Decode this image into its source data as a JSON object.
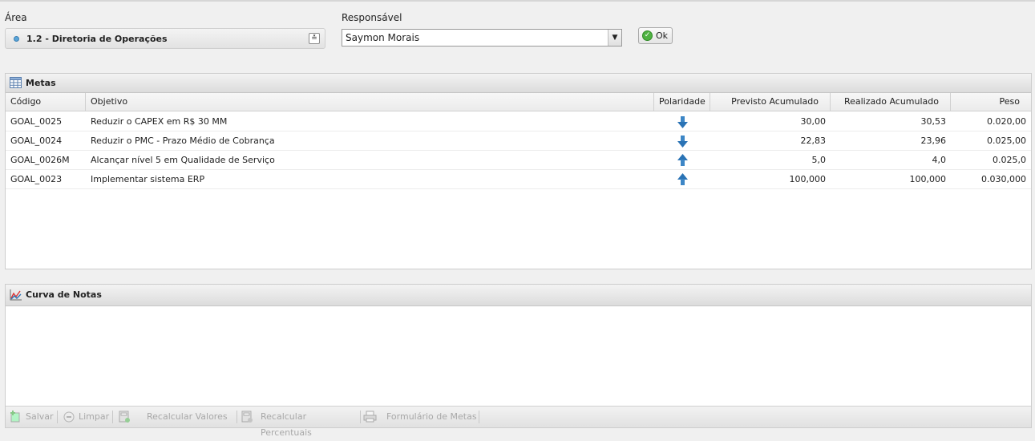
{
  "filters": {
    "area_label": "Área",
    "area_value": "1.2 - Diretoria de Operações",
    "responsavel_label": "Responsável",
    "responsavel_value": "Saymon Morais",
    "ok_label": "Ok"
  },
  "metas": {
    "title": "Metas",
    "columns": [
      "Código",
      "Objetivo",
      "Polaridade",
      "Previsto Acumulado",
      "Realizado Acumulado",
      "Peso"
    ],
    "rows": [
      {
        "codigo": "GOAL_0025",
        "objetivo": "Reduzir o CAPEX em R$ 30 MM",
        "polaridade": "down",
        "previsto": "30,00",
        "realizado": "30,53",
        "peso": "0.020,00"
      },
      {
        "codigo": "GOAL_0024",
        "objetivo": "Reduzir o PMC - Prazo Médio de Cobrança",
        "polaridade": "down",
        "previsto": "22,83",
        "realizado": "23,96",
        "peso": "0.025,00"
      },
      {
        "codigo": "GOAL_0026M",
        "objetivo": "Alcançar nível 5 em Qualidade de Serviço",
        "polaridade": "up",
        "previsto": "5,0",
        "realizado": "4,0",
        "peso": "0.025,0"
      },
      {
        "codigo": "GOAL_0023",
        "objetivo": "Implementar sistema ERP",
        "polaridade": "up",
        "previsto": "100,000",
        "realizado": "100,000",
        "peso": "0.030,000"
      }
    ]
  },
  "curva": {
    "title": "Curva de Notas"
  },
  "toolbar": {
    "salvar": "Salvar",
    "limpar": "Limpar",
    "recalcular_valores": "Recalcular Valores",
    "recalcular_percentuais": "Recalcular Percentuais",
    "formulario": "Formulário de Metas"
  }
}
